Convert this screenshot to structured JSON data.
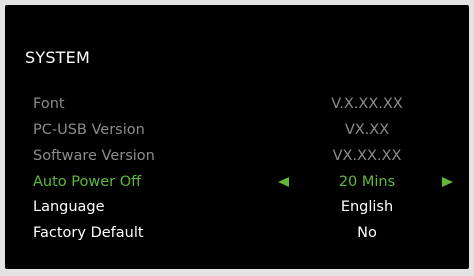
{
  "screen": {
    "title": "SYSTEM"
  },
  "colors": {
    "background": "#000000",
    "text": "#ffffff",
    "disabled_text": "#8c8c8c",
    "highlight": "#5fba3a"
  },
  "menu": {
    "items": [
      {
        "label": "Font",
        "value": "V.X.XX.XX",
        "state": "disabled"
      },
      {
        "label": "PC-USB Version",
        "value": "VX.XX",
        "state": "disabled"
      },
      {
        "label": "Software Version",
        "value": "VX.XX.XX",
        "state": "disabled"
      },
      {
        "label": "Auto Power Off",
        "value": "20 Mins",
        "state": "selected",
        "icons": [
          "left-arrow-icon",
          "right-arrow-icon"
        ]
      },
      {
        "label": "Language",
        "value": "English",
        "state": "normal"
      },
      {
        "label": "Factory Default",
        "value": "No",
        "state": "normal"
      }
    ]
  }
}
